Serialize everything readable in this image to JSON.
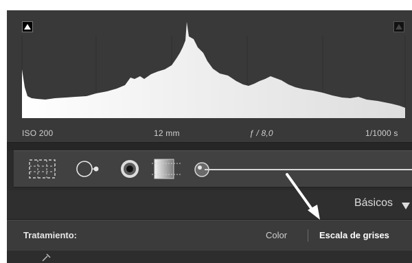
{
  "histogram": {
    "iso": "ISO 200",
    "focal_length": "12 mm",
    "aperture": "ƒ / 8,0",
    "shutter": "1/1000 s",
    "shadow_clip_icon": "triangle-up-icon",
    "highlight_clip_icon": "triangle-up-icon"
  },
  "tools": {
    "icons": [
      "crop-overlay-icon",
      "spot-removal-icon",
      "red-eye-icon",
      "graduated-filter-icon",
      "adjustment-brush-icon"
    ]
  },
  "panel": {
    "title": "Básicos",
    "collapse_icon": "triangle-down-icon"
  },
  "treatment": {
    "label": "Tratamiento:",
    "option_color": "Color",
    "option_grayscale": "Escala de grises",
    "selected": "Escala de grises"
  },
  "colors": {
    "panel_bg": "#2b2b2b",
    "histogram_bg": "#393939",
    "text": "#dcdcdc",
    "annotation": "#ffffff"
  }
}
